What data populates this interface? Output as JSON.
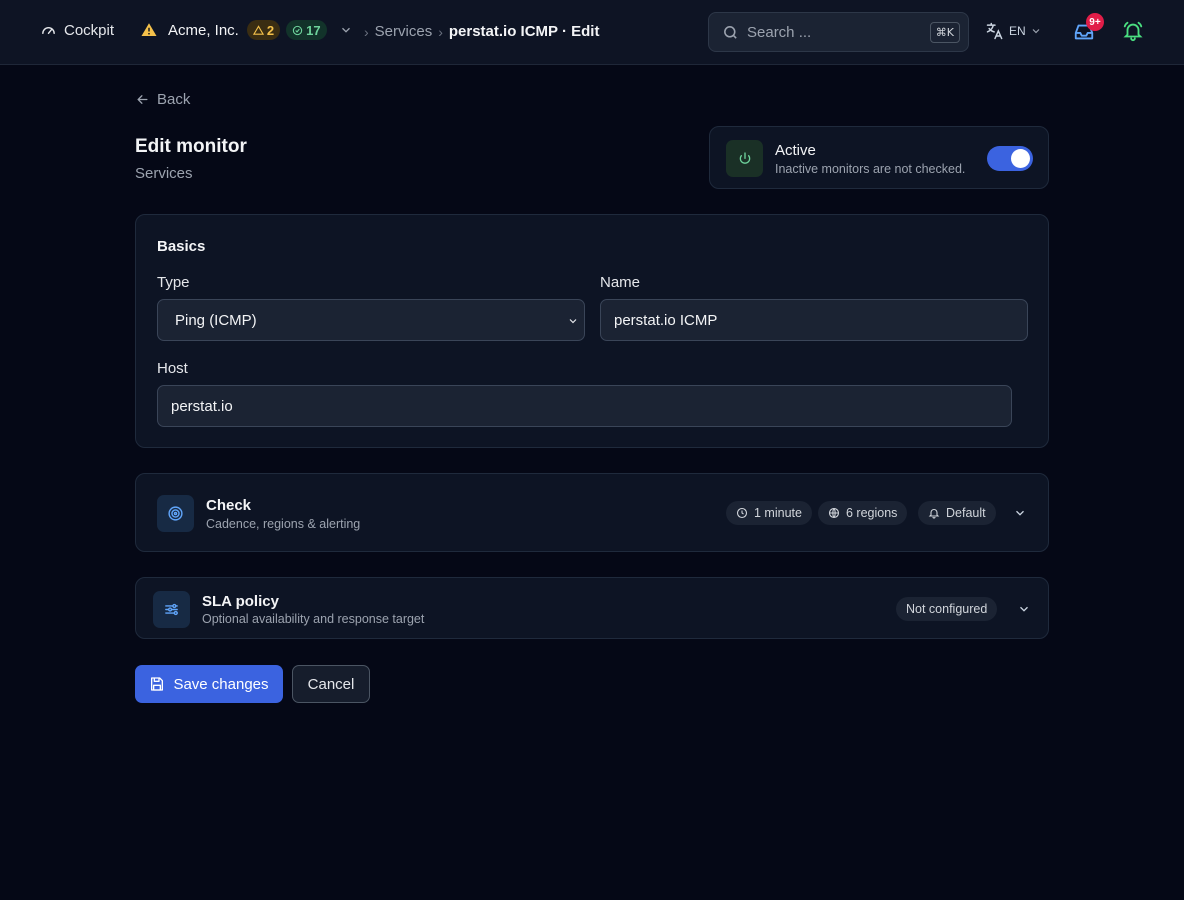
{
  "header": {
    "brand": "Cockpit",
    "org_name": "Acme, Inc.",
    "warn_count": "2",
    "ok_count": "17",
    "breadcrumb_parent": "Services",
    "breadcrumb_current": "perstat.io ICMP · Edit",
    "search_placeholder": "Search ...",
    "search_shortcut": "⌘K",
    "language": "EN",
    "inbox_badge": "9+"
  },
  "page": {
    "back_label": "Back",
    "title": "Edit monitor",
    "subtitle": "Services"
  },
  "active_toggle": {
    "title": "Active",
    "description": "Inactive monitors are not checked.",
    "enabled": true
  },
  "basics": {
    "title": "Basics",
    "type_label": "Type",
    "type_value": "Ping (ICMP)",
    "name_label": "Name",
    "name_value": "perstat.io ICMP",
    "host_label": "Host",
    "host_value": "perstat.io"
  },
  "check": {
    "title": "Check",
    "description": "Cadence, regions & alerting",
    "interval": "1 minute",
    "regions": "6 regions",
    "alerting": "Default"
  },
  "sla": {
    "title": "SLA policy",
    "description": "Optional availability and response target",
    "status": "Not configured"
  },
  "actions": {
    "save_label": "Save changes",
    "cancel_label": "Cancel"
  },
  "colors": {
    "background": "#050816",
    "card": "#0d1424",
    "primary": "#3b63e0",
    "success": "#6ed39c",
    "warning": "#f4c14b",
    "danger": "#e11d48"
  }
}
